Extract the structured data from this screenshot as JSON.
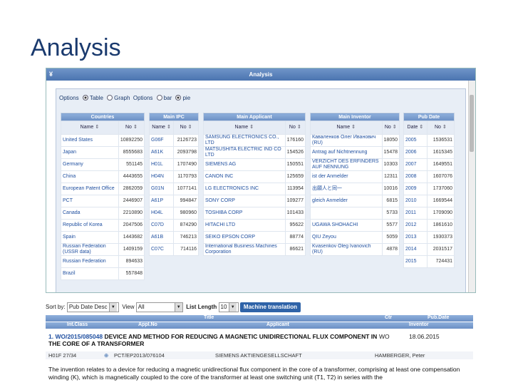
{
  "slide": {
    "title": "Analysis"
  },
  "window": {
    "title": "Analysis",
    "options_label": "Options",
    "options_1": [
      "Table",
      "Graph"
    ],
    "options_label_2": "Options",
    "options_2": [
      "bar",
      "pie"
    ]
  },
  "countries": {
    "header": "Countries",
    "col_name": "Name",
    "col_no": "No",
    "rows": [
      [
        "United States",
        "10892250"
      ],
      [
        "Japan",
        "8555683"
      ],
      [
        "Germany",
        "551145"
      ],
      [
        "China",
        "4443655"
      ],
      [
        "European Patent Office",
        "2862059"
      ],
      [
        "PCT",
        "2446907"
      ],
      [
        "Canada",
        "2210890"
      ],
      [
        "Republic of Korea",
        "2047506"
      ],
      [
        "Spain",
        "1443682"
      ],
      [
        "Russian Federation (USSR data)",
        "1409159"
      ],
      [
        "Russian Federation",
        "894633"
      ],
      [
        "Brazil",
        "557848"
      ]
    ]
  },
  "ipc": {
    "header": "Main IPC",
    "col_name": "Name",
    "col_no": "No",
    "rows": [
      [
        "G06F",
        "2126723"
      ],
      [
        "A61K",
        "2093798"
      ],
      [
        "H01L",
        "1707490"
      ],
      [
        "H04N",
        "1170793"
      ],
      [
        "G01N",
        "1077141"
      ],
      [
        "A61P",
        "994847"
      ],
      [
        "H04L",
        "980960"
      ],
      [
        "C07D",
        "874290"
      ],
      [
        "A61B",
        "746213"
      ],
      [
        "C07C",
        "714116"
      ]
    ]
  },
  "applicant": {
    "header": "Main Applicant",
    "col_name": "Name",
    "col_no": "No",
    "rows": [
      [
        "SAMSUNG ELECTRONICS CO., LTD",
        "176160"
      ],
      [
        "MATSUSHITA ELECTRIC IND CO LTD",
        "154526"
      ],
      [
        "SIEMENS AG",
        "150551"
      ],
      [
        "CANON INC",
        "125659"
      ],
      [
        "LG ELECTRONICS INC",
        "113954"
      ],
      [
        "SONY CORP",
        "109277"
      ],
      [
        "TOSHIBA CORP",
        "101433"
      ],
      [
        "HITACHI LTD",
        "95622"
      ],
      [
        "SEIKO EPSON CORP",
        "88774"
      ],
      [
        "International Business Machines Corporation",
        "86621"
      ]
    ]
  },
  "inventor": {
    "header": "Main Inventor",
    "col_name": "Name",
    "col_no": "No",
    "rows": [
      [
        "Каваленков Олег Иванович (RU)",
        "18050"
      ],
      [
        "Antrag auf Nichtnennung",
        "15478"
      ],
      [
        "VERZICHT DES ERFINDERS AUF NENNUNG",
        "10303"
      ],
      [
        "ist der Anmelder",
        "12311"
      ],
      [
        "出願人と同一",
        "10016"
      ],
      [
        "gleich Anmelder",
        "6815"
      ],
      [
        "",
        "5733"
      ],
      [
        "UGAWA SHOHACHI",
        "5577"
      ],
      [
        "QIU Zeyou",
        "5059"
      ],
      [
        "Kvasenkov Oleg Ivanovich (RU)",
        "4878"
      ]
    ]
  },
  "pubdate": {
    "header": "Pub Date",
    "col_date": "Date",
    "col_no": "No",
    "rows": [
      [
        "2005",
        "1536531"
      ],
      [
        "2006",
        "1615345"
      ],
      [
        "2007",
        "1649551"
      ],
      [
        "2008",
        "1607076"
      ],
      [
        "2009",
        "1737060"
      ],
      [
        "2010",
        "1669544"
      ],
      [
        "2011",
        "1709090"
      ],
      [
        "2012",
        "1861610"
      ],
      [
        "2013",
        "1930373"
      ],
      [
        "2014",
        "2031517"
      ],
      [
        "2015",
        "724431"
      ]
    ]
  },
  "toolbar": {
    "sort_label": "Sort by:",
    "sort_value": "Pub Date Desc",
    "view_label": "View",
    "view_value": "All",
    "list_length_label": "List Length",
    "list_length_value": "10",
    "machine_translation": "Machine translation"
  },
  "results_header": {
    "title": "Title",
    "ctr": "Ctr",
    "pubdate": "Pub.Date",
    "intclass": "Int.Class",
    "applno": "Appl.No",
    "applicant": "Applicant",
    "inventor": "Inventor"
  },
  "result": {
    "number": "1. WO/2015/085048",
    "title": "DEVICE AND METHOD FOR REDUCING A MAGNETIC UNIDIRECTIONAL FLUX COMPONENT IN THE CORE OF A TRANSFORMER",
    "country": "WO",
    "pub_date": "18.06.2015",
    "int_class": "H01F 27/34",
    "appl_no": "PCT/EP2013/076104",
    "applicant": "SIEMENS AKTIENGESELLSCHAFT",
    "inventor": "HAMBERGER, Peter",
    "abstract": "The invention relates to a device for reducing a magnetic unidirectional flux component in the core of a transformer, comprising at least one compensation winding (K), which is magnetically coupled to the core of the transformer at least one switching unit (T1, T2) in series with the"
  },
  "colors": {
    "header_blue": "#6b8fc4",
    "title_blue": "#1a3a6e",
    "link_blue": "#2050a0",
    "button_blue": "#2f63a8"
  }
}
